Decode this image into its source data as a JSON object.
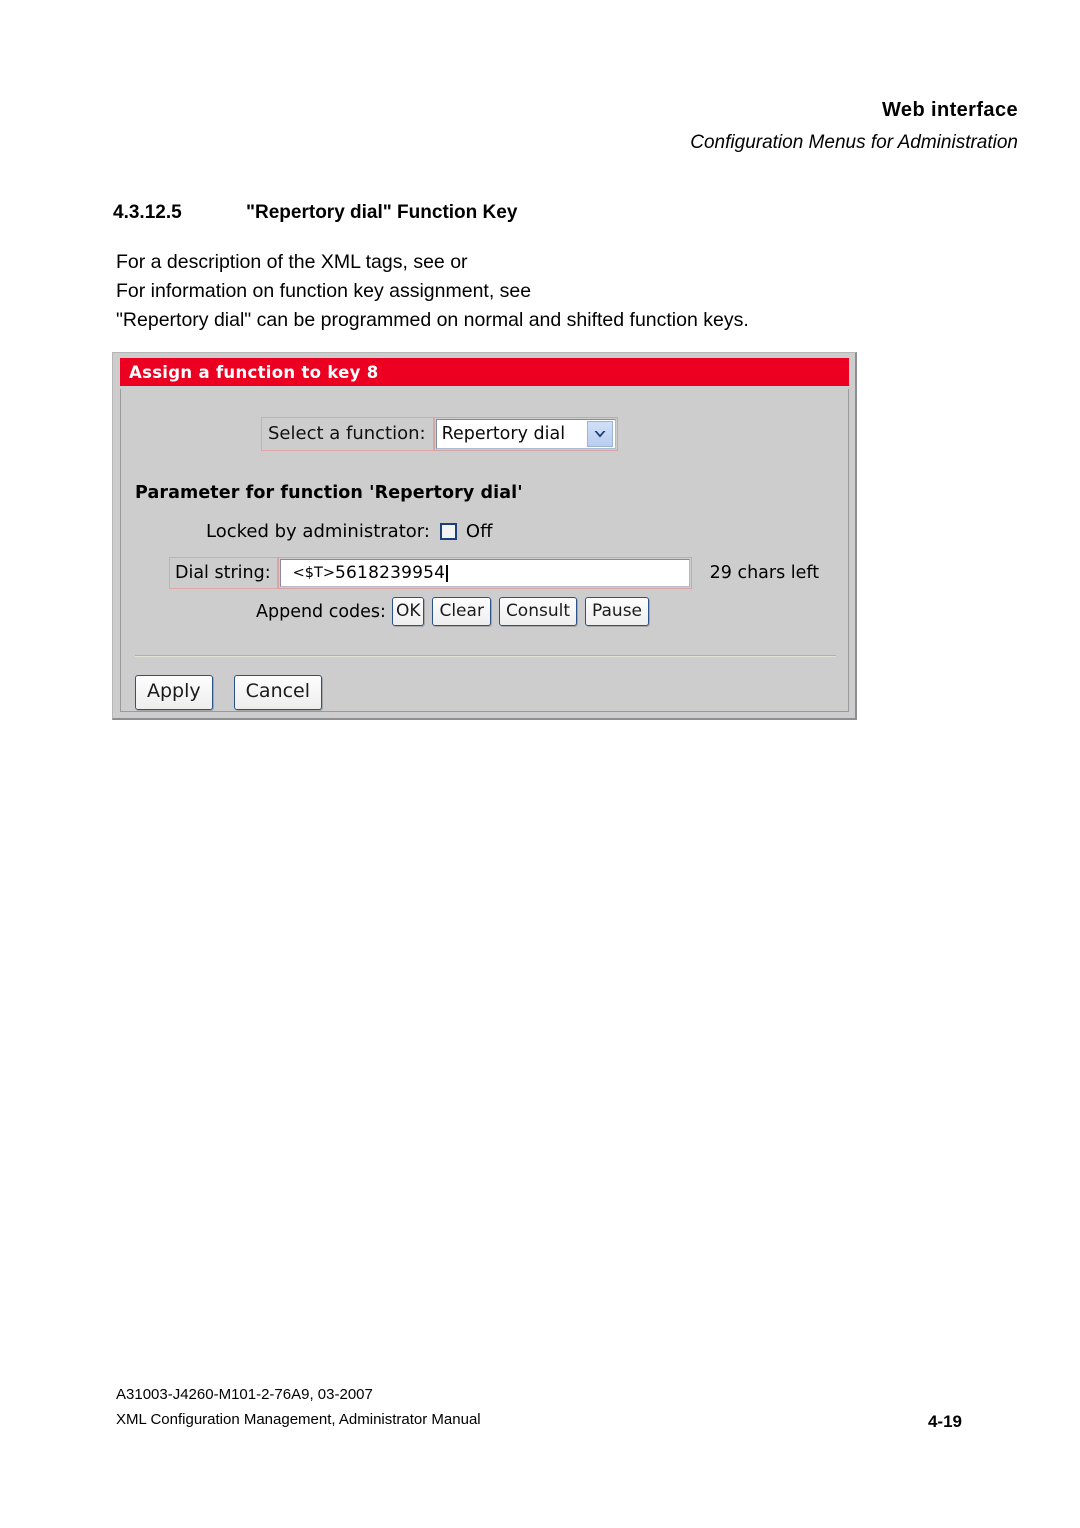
{
  "header": {
    "title": "Web interface",
    "subtitle": "Configuration Menus for Administration"
  },
  "section": {
    "number": "4.3.12.5",
    "title": "\"Repertory dial\" Function Key"
  },
  "body": {
    "line1": "For a description of the XML tags, see  or",
    "line2": "For information on function key assignment, see",
    "line3": "\"Repertory dial\" can be programmed on normal and shifted function keys."
  },
  "figure": {
    "titlebar": "Assign a function to key 8",
    "select_label": "Select a function:",
    "select_value": "Repertory dial",
    "select_options": [
      "Repertory dial"
    ],
    "param_heading": "Parameter for function 'Repertory dial'",
    "locked_label": "Locked by administrator:",
    "locked_state": "Off",
    "dial_label": "Dial string:",
    "dial_tag": "<$T>",
    "dial_number": " 5618239954",
    "chars_left": "29 chars left",
    "append_label": "Append codes:",
    "append_buttons": [
      "OK",
      "Clear",
      "Consult",
      "Pause"
    ],
    "apply_label": "Apply",
    "cancel_label": "Cancel",
    "colors": {
      "titlebar_red": "#ec0022",
      "dialog_gray": "#cdcdcd",
      "button_border_blue": "#2a5288",
      "dropdown_blue": "#b9cdef"
    }
  },
  "footer": {
    "doc_id": "A31003-J4260-M101-2-76A9, 03-2007",
    "doc_title": "XML Configuration Management, Administrator Manual",
    "page_number": "4-19"
  }
}
